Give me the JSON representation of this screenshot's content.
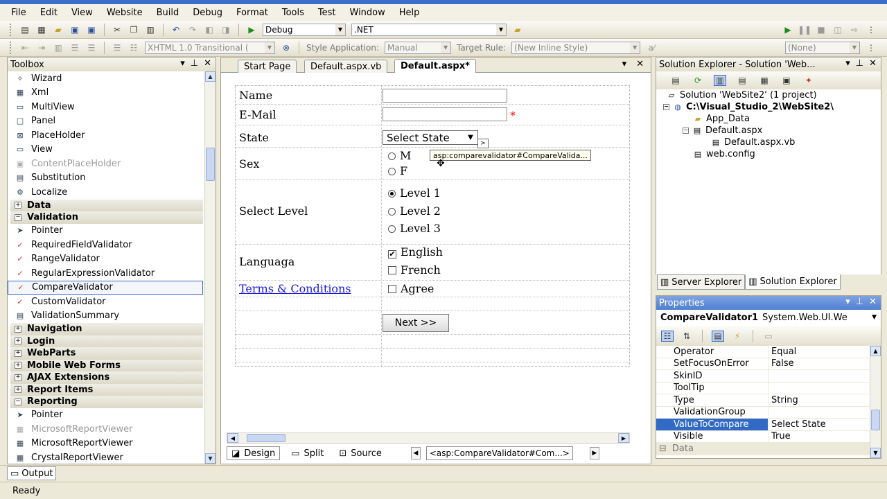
{
  "menu": [
    "File",
    "Edit",
    "View",
    "Website",
    "Build",
    "Debug",
    "Format",
    "Tools",
    "Test",
    "Window",
    "Help"
  ],
  "toolbar1": {
    "config": "Debug",
    "platform": ".NET"
  },
  "toolbar2": {
    "doctype": "XHTML 1.0 Transitional (",
    "style_app_label": "Style Application:",
    "style_app_value": "Manual",
    "target_rule_label": "Target Rule:",
    "target_rule_value": "(New Inline Style)",
    "none_value": "(None)"
  },
  "toolbox": {
    "title": "Toolbox",
    "rows": [
      {
        "kind": "item",
        "label": "Wizard",
        "icon": "wizard-icon",
        "glyph": "✧"
      },
      {
        "kind": "item",
        "label": "Xml",
        "icon": "xml-icon",
        "glyph": "▦"
      },
      {
        "kind": "item",
        "label": "MultiView",
        "icon": "multiview-icon",
        "glyph": "▭"
      },
      {
        "kind": "item",
        "label": "Panel",
        "icon": "panel-icon",
        "glyph": "□"
      },
      {
        "kind": "item",
        "label": "PlaceHolder",
        "icon": "placeholder-icon",
        "glyph": "⊠"
      },
      {
        "kind": "item",
        "label": "View",
        "icon": "view-icon",
        "glyph": "▭"
      },
      {
        "kind": "item",
        "label": "ContentPlaceHolder",
        "icon": "contentplaceholder-icon",
        "glyph": "▣",
        "dim": true
      },
      {
        "kind": "item",
        "label": "Substitution",
        "icon": "substitution-icon",
        "glyph": "▤"
      },
      {
        "kind": "item",
        "label": "Localize",
        "icon": "localize-icon",
        "glyph": "⚙"
      },
      {
        "kind": "cat",
        "label": "Data",
        "sign": "+"
      },
      {
        "kind": "cat",
        "label": "Validation",
        "sign": "−"
      },
      {
        "kind": "item",
        "label": "Pointer",
        "icon": "pointer-icon",
        "glyph": "➤"
      },
      {
        "kind": "item",
        "label": "RequiredFieldValidator",
        "icon": "requiredfieldvalidator-icon",
        "glyph": "✓"
      },
      {
        "kind": "item",
        "label": "RangeValidator",
        "icon": "rangevalidator-icon",
        "glyph": "✓"
      },
      {
        "kind": "item",
        "label": "RegularExpressionValidator",
        "icon": "regularexpressionvalidator-icon",
        "glyph": "✓"
      },
      {
        "kind": "item",
        "label": "CompareValidator",
        "icon": "comparevalidator-icon",
        "glyph": "✓",
        "selected": true
      },
      {
        "kind": "item",
        "label": "CustomValidator",
        "icon": "customvalidator-icon",
        "glyph": "✓"
      },
      {
        "kind": "item",
        "label": "ValidationSummary",
        "icon": "validationsummary-icon",
        "glyph": "▤"
      },
      {
        "kind": "cat",
        "label": "Navigation",
        "sign": "+"
      },
      {
        "kind": "cat",
        "label": "Login",
        "sign": "+"
      },
      {
        "kind": "cat",
        "label": "WebParts",
        "sign": "+"
      },
      {
        "kind": "cat",
        "label": "Mobile Web Forms",
        "sign": "+"
      },
      {
        "kind": "cat",
        "label": "AJAX Extensions",
        "sign": "+"
      },
      {
        "kind": "cat",
        "label": "Report Items",
        "sign": "+"
      },
      {
        "kind": "cat",
        "label": "Reporting",
        "sign": "−"
      },
      {
        "kind": "item",
        "label": "Pointer",
        "icon": "pointer-icon",
        "glyph": "➤"
      },
      {
        "kind": "item",
        "label": "MicrosoftReportViewer",
        "icon": "reportviewer-icon",
        "glyph": "▦",
        "dim": true
      },
      {
        "kind": "item",
        "label": "MicrosoftReportViewer",
        "icon": "reportviewer-icon",
        "glyph": "▦"
      },
      {
        "kind": "item",
        "label": "CrystalReportViewer",
        "icon": "crystalreportviewer-icon",
        "glyph": "▦"
      }
    ]
  },
  "doc": {
    "tabs": [
      "Start Page",
      "Default.aspx.vb",
      "Default.aspx*"
    ],
    "form": {
      "name_label": "Name",
      "email_label": "E-Mail",
      "required_mark": "*",
      "state_label": "State",
      "state_select": "Select State",
      "validator_tag": "asp:comparevalidator#CompareValida...",
      "smart_tag": ">",
      "sex_label": "Sex",
      "sex_options": [
        "M",
        "F"
      ],
      "level_label": "Select Level",
      "level_options": [
        "Level 1",
        "Level 2",
        "Level 3"
      ],
      "language_label": "Languaga",
      "language_options": [
        "English",
        "French"
      ],
      "terms_link": "Terms & Conditions",
      "agree_label": "Agree",
      "next_button": "Next >>"
    },
    "views": [
      "Design",
      "Split",
      "Source"
    ],
    "breadcrumb": "<asp:CompareValidator#Com...>"
  },
  "solution": {
    "title": "Solution Explorer - Solution 'Web...",
    "nodes": {
      "solution": "Solution 'WebSite2' (1 project)",
      "project": "C:\\Visual_Studio_2\\WebSite2\\",
      "app_data": "App_Data",
      "default": "Default.aspx",
      "default_vb": "Default.aspx.vb",
      "webconfig": "web.config"
    },
    "tabs": [
      "Server Explorer",
      "Solution Explorer"
    ]
  },
  "properties": {
    "title": "Properties",
    "object": "CompareValidator1",
    "object_type": "System.Web.UI.We",
    "rows": [
      {
        "name": "Operator",
        "value": "Equal"
      },
      {
        "name": "SetFocusOnError",
        "value": "False"
      },
      {
        "name": "SkinID",
        "value": ""
      },
      {
        "name": "ToolTip",
        "value": ""
      },
      {
        "name": "Type",
        "value": "String"
      },
      {
        "name": "ValidationGroup",
        "value": ""
      },
      {
        "name": "ValueToCompare",
        "value": "Select State",
        "selected": true
      },
      {
        "name": "Visible",
        "value": "True"
      }
    ],
    "category": "Data"
  },
  "output_tab": "Output",
  "status": "Ready",
  "colors": {
    "selection": "#316ac5",
    "required": "#ff0000",
    "link": "#1a1ad6"
  }
}
